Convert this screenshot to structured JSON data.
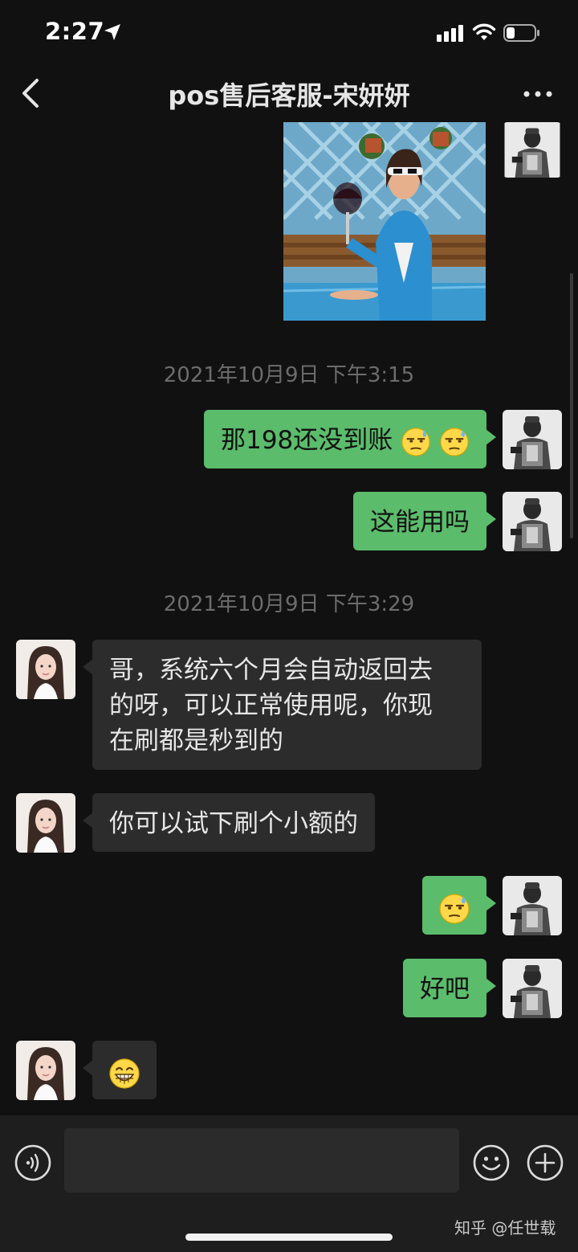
{
  "status_bar": {
    "time": "2:27"
  },
  "nav": {
    "title": "pos售后客服-宋妍妍"
  },
  "messages": {
    "ts1": "2021年10月9日 下午3:15",
    "m1": "那198还没到账",
    "m2": "这能用吗",
    "ts2": "2021年10月9日 下午3:29",
    "m3_l1": "哥，系统六个月会自动返回去",
    "m3_l2": "的呀，可以正常使用呢，你现",
    "m3_l3": "在刷都是秒到的",
    "m4": "你可以试下刷个小额的",
    "m6": "好吧"
  },
  "input": {
    "placeholder": ""
  },
  "watermark": "知乎 @任世载",
  "colors": {
    "background": "#111111",
    "outgoing_bubble": "#5bbc6b",
    "incoming_bubble": "#2c2c2c",
    "input_bar": "#1e1e1e"
  },
  "icons": [
    "location-arrow-icon",
    "signal-icon",
    "wifi-icon",
    "battery-icon",
    "back-icon",
    "more-icon",
    "voice-icon",
    "emoji-icon",
    "plus-icon",
    "sweat-emoji-icon",
    "grin-emoji-icon"
  ]
}
